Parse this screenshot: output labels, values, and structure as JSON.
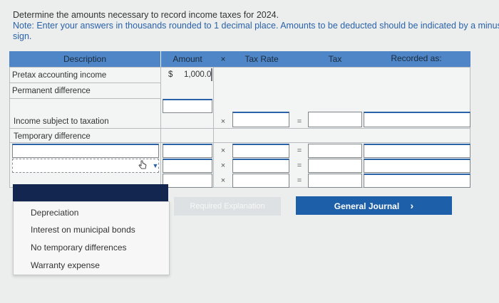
{
  "instructions": {
    "line1": "Determine the amounts necessary to record income taxes for 2024.",
    "note": "Note: Enter your answers in thousands rounded to 1 decimal place. Amounts to be deducted should be indicated by a minus sign."
  },
  "table": {
    "headers": {
      "description": "Description",
      "amount": "Amount",
      "times": "×",
      "tax_rate": "Tax Rate",
      "tax": "Tax",
      "recorded_as": "Recorded as:"
    },
    "rows": {
      "pretax_label": "Pretax accounting income",
      "pretax_currency": "$",
      "pretax_amount": "1,000.0",
      "permanent_label": "Permanent difference",
      "income_subject_label": "Income subject to taxation",
      "temporary_label": "Temporary difference"
    },
    "operators": {
      "times": "×",
      "equals": "="
    }
  },
  "dropdown": {
    "options": [
      "Depreciation",
      "Interest on municipal bonds",
      "No temporary differences",
      "Warranty expense"
    ]
  },
  "buttons": {
    "ghost_label": "Required Explanation",
    "general_journal": "General Journal",
    "general_journal_chevron": "›"
  },
  "colors": {
    "header_bg": "#4e86c8",
    "note_text": "#2a62a8",
    "dropdown_bar": "#13264f",
    "button_primary": "#1d5fa8"
  }
}
